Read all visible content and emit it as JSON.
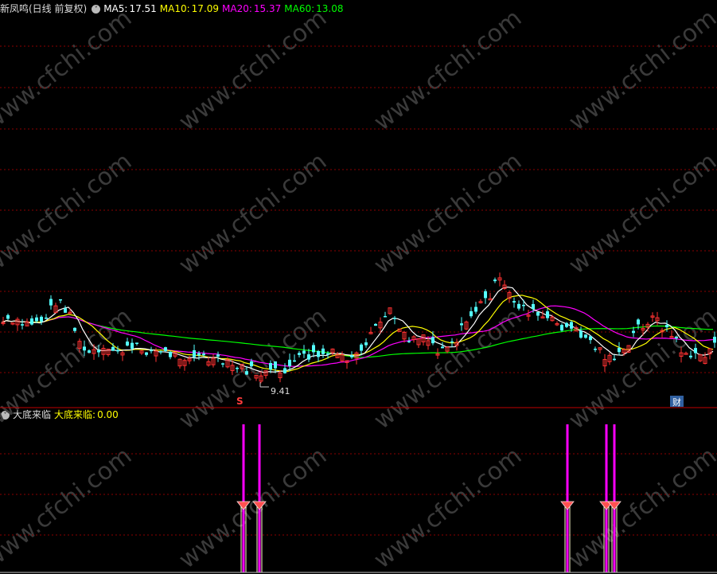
{
  "main_panel": {
    "stock_label": "新凤鸣(日线 前复权)",
    "toggle_icon": "chevron-down-icon",
    "ma": [
      {
        "label": "MA5:",
        "value": "17.51",
        "color": "#ffffff"
      },
      {
        "label": "MA10:",
        "value": "17.09",
        "color": "#ffff00"
      },
      {
        "label": "MA20:",
        "value": "15.37",
        "color": "#ff00ff"
      },
      {
        "label": "MA60:",
        "value": "13.08",
        "color": "#00ff00"
      }
    ],
    "low_marker": "9.41",
    "marker_s": "S",
    "marker_cai": "财"
  },
  "indicator_panel": {
    "name": "大底来临",
    "label": "大底来临:",
    "value": "0.00",
    "toggle_icon": "chevron-down-icon"
  },
  "watermark": "www.cfchi.com",
  "colors": {
    "up": "#ff3232",
    "down": "#54ffff",
    "grid": "#8b0000",
    "signal": "#ff00ff",
    "signal_cap": "#ff5050"
  }
}
